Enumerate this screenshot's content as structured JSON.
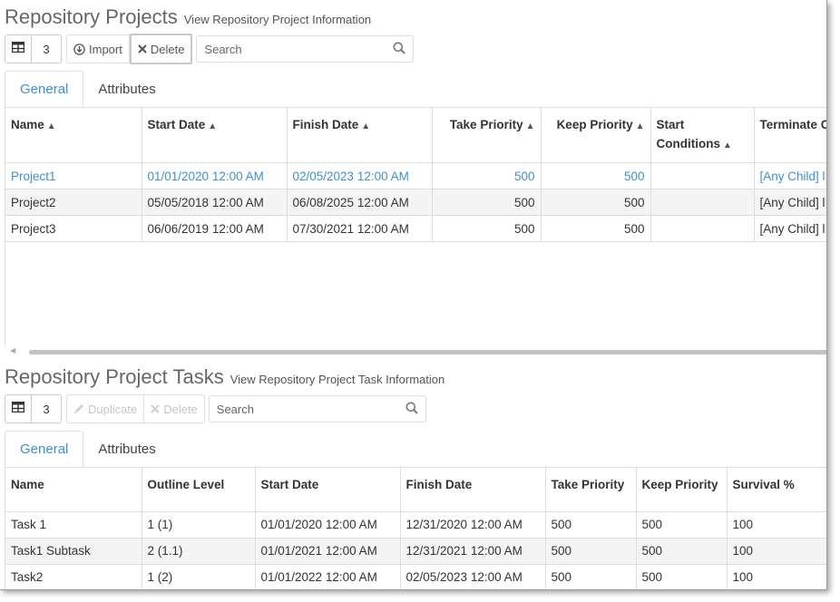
{
  "projects": {
    "title": "Repository Projects",
    "subtitle": "View Repository Project Information",
    "toolbar": {
      "count": "3",
      "import_label": "Import",
      "delete_label": "Delete",
      "search_placeholder": "Search"
    },
    "tabs": [
      "General",
      "Attributes"
    ],
    "columns": [
      "Name",
      "Start Date",
      "Finish Date",
      "Take Priority",
      "Keep Priority",
      "Start Conditions",
      "Terminate Conditions"
    ],
    "rows": [
      [
        "Project1",
        "01/01/2020 12:00 AM",
        "02/05/2023 12:00 AM",
        "500",
        "500",
        "",
        "[Any Child] l"
      ],
      [
        "Project2",
        "05/05/2018 12:00 AM",
        "06/08/2025 12:00 AM",
        "500",
        "500",
        "",
        "[Any Child] l"
      ],
      [
        "Project3",
        "06/06/2019 12:00 AM",
        "07/30/2021 12:00 AM",
        "500",
        "500",
        "",
        "[Any Child] l"
      ]
    ]
  },
  "tasks": {
    "title": "Repository Project Tasks",
    "subtitle": "View Repository Project Task Information",
    "toolbar": {
      "count": "3",
      "duplicate_label": "Duplicate",
      "delete_label": "Delete",
      "search_placeholder": "Search"
    },
    "tabs": [
      "General",
      "Attributes"
    ],
    "columns": [
      "Name",
      "Outline Level",
      "Start Date",
      "Finish Date",
      "Take Priority",
      "Keep Priority",
      "Survival %"
    ],
    "rows": [
      [
        "Task 1",
        "1 (1)",
        "01/01/2020 12:00 AM",
        "12/31/2020 12:00 AM",
        "500",
        "500",
        "100"
      ],
      [
        "Task1 Subtask",
        "2 (1.1)",
        "01/01/2021 12:00 AM",
        "12/31/2021 12:00 AM",
        "500",
        "500",
        "100"
      ],
      [
        "Task2",
        "1 (2)",
        "01/01/2022 12:00 AM",
        "02/05/2023 12:00 AM",
        "500",
        "500",
        "100"
      ]
    ]
  },
  "colors": {
    "accent": "#3c91cf",
    "border": "#dddddd",
    "row_alt": "#f4f4f4"
  }
}
